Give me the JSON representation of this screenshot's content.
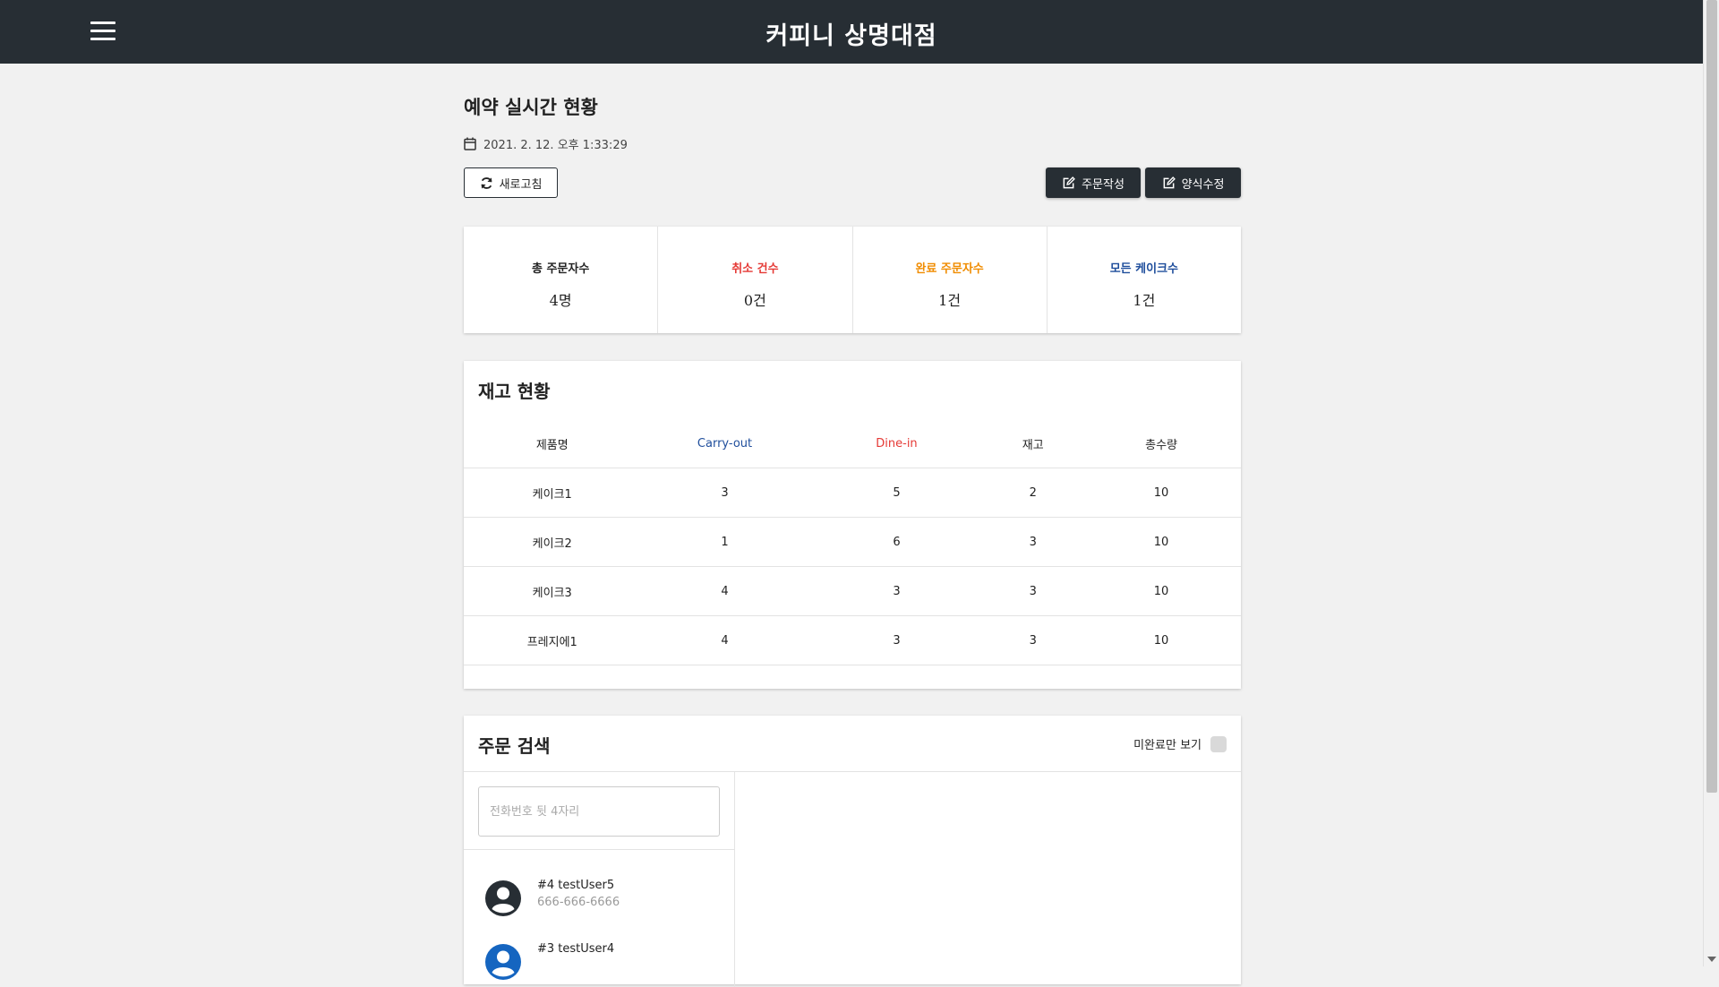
{
  "header": {
    "title": "커피니 상명대점",
    "menu_icon": "hamburger-icon"
  },
  "page": {
    "title": "예약 실시간 현황",
    "datetime": "2021. 2. 12. 오후 1:33:29"
  },
  "buttons": {
    "refresh": "새로고침",
    "write_order": "주문작성",
    "edit_form": "양식수정"
  },
  "stats": [
    {
      "label": "총 주문자수",
      "value": "4명",
      "color": "#222222"
    },
    {
      "label": "취소 건수",
      "value": "0건",
      "color": "#e53935"
    },
    {
      "label": "완료 주문자수",
      "value": "1건",
      "color": "#f08c00"
    },
    {
      "label": "모든 케이크수",
      "value": "1건",
      "color": "#1f4e9c"
    }
  ],
  "inventory": {
    "title": "재고 현황",
    "headers": [
      "제품명",
      "Carry-out",
      "Dine-in",
      "재고",
      "총수량"
    ],
    "header_colors": [
      "#222222",
      "#1f4e9c",
      "#e53935",
      "#222222",
      "#222222"
    ],
    "rows": [
      [
        "케이크1",
        "3",
        "5",
        "2",
        "10"
      ],
      [
        "케이크2",
        "1",
        "6",
        "3",
        "10"
      ],
      [
        "케이크3",
        "4",
        "3",
        "3",
        "10"
      ],
      [
        "프레지에1",
        "4",
        "3",
        "3",
        "10"
      ]
    ]
  },
  "order_search": {
    "title": "주문 검색",
    "pending_only_label": "미완료만 보기",
    "pending_only_checked": false,
    "search_placeholder": "전화번호 뒷 4자리",
    "users": [
      {
        "name": "#4 testUser5",
        "phone": "666-666-6666",
        "avatar_color": "#272e34"
      },
      {
        "name": "#3 testUser4",
        "phone": "",
        "avatar_color": "#1565c0"
      }
    ]
  }
}
